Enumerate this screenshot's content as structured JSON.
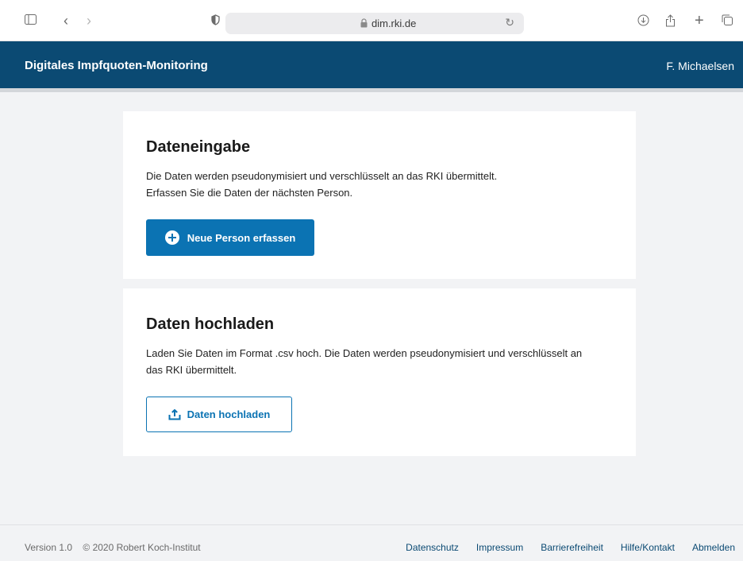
{
  "browser": {
    "url": "dim.rki.de",
    "icons": [
      "sidebar-icon",
      "back-icon",
      "forward-icon",
      "shield-icon",
      "lock-icon",
      "reload-icon",
      "download-icon",
      "share-icon",
      "new-tab-icon",
      "tabs-icon"
    ]
  },
  "header": {
    "title": "Digitales Impfquoten-Monitoring",
    "user": "F. Michaelsen"
  },
  "data_entry": {
    "title": "Dateneingabe",
    "line1": "Die Daten werden pseudonymisiert und verschlüsselt an das RKI übermittelt.",
    "line2": "Erfassen Sie die Daten der nächsten Person.",
    "button_label": "Neue Person erfassen"
  },
  "upload": {
    "title": "Daten hochladen",
    "line1": "Laden Sie Daten im Format .csv hoch. Die Daten werden pseudonymisiert und verschlüsselt an",
    "line2": "das RKI übermittelt.",
    "button_label": "Daten hochladen"
  },
  "footer": {
    "version": "Version 1.0",
    "copyright": "© 2020 Robert Koch-Institut",
    "links": [
      "Datenschutz",
      "Impressum",
      "Barrierefreiheit",
      "Hilfe/Kontakt",
      "Abmelden"
    ]
  },
  "colors": {
    "header_bg": "#0b4a73",
    "primary": "#0b73b3",
    "page_bg": "#f2f3f5"
  }
}
